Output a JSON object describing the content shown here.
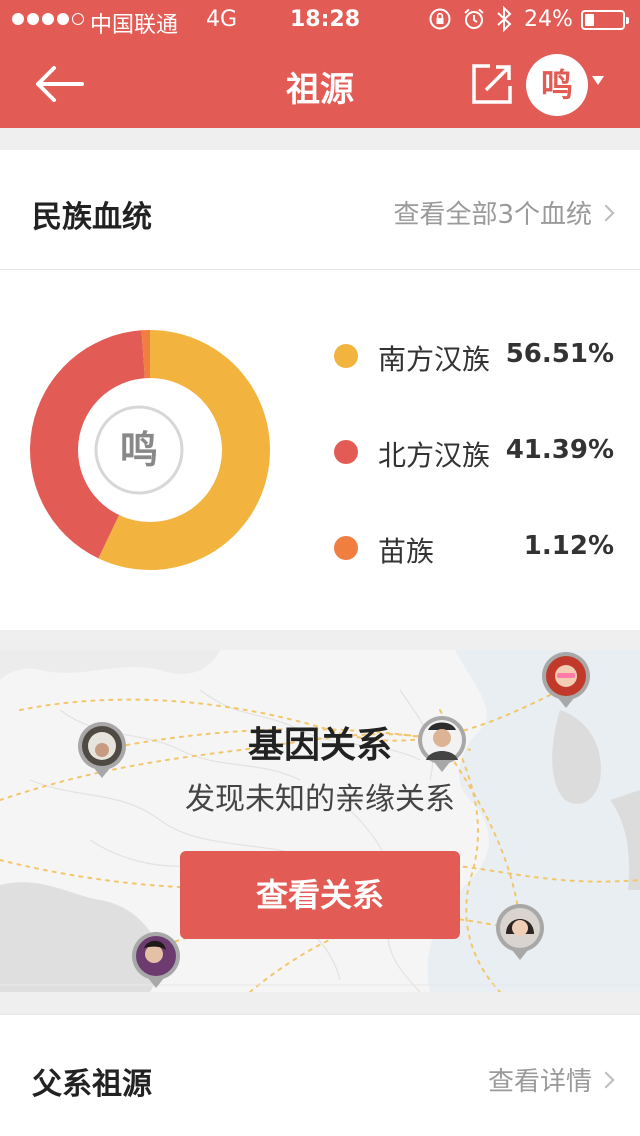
{
  "status_bar": {
    "carrier": "中国联通",
    "network": "4G",
    "time": "18:28",
    "battery": "24%",
    "battery_level": 0.24,
    "icons": [
      "rotation-lock-icon",
      "alarm-icon",
      "bluetooth-icon"
    ]
  },
  "nav": {
    "title": "祖源",
    "avatar_char": "鸣"
  },
  "ethnic_section": {
    "title": "民族血统",
    "link_label": "查看全部3个血统"
  },
  "chart_data": {
    "type": "pie",
    "center_label": "鸣",
    "series": [
      {
        "name": "南方汉族",
        "value": 56.51,
        "label": "56.51%",
        "color": "#f3b33f"
      },
      {
        "name": "北方汉族",
        "value": 41.39,
        "label": "41.39%",
        "color": "#e35b55"
      },
      {
        "name": "苗族",
        "value": 1.12,
        "label": "1.12%",
        "color": "#ef7e40"
      }
    ]
  },
  "gene_section": {
    "title": "基因关系",
    "subtitle": "发现未知的亲缘关系",
    "button_label": "查看关系"
  },
  "paternal_section": {
    "title": "父系祖源",
    "link_label": "查看详情"
  },
  "colors": {
    "brand": "#e35b55",
    "text": "#333333",
    "muted": "#9a9a9a"
  }
}
